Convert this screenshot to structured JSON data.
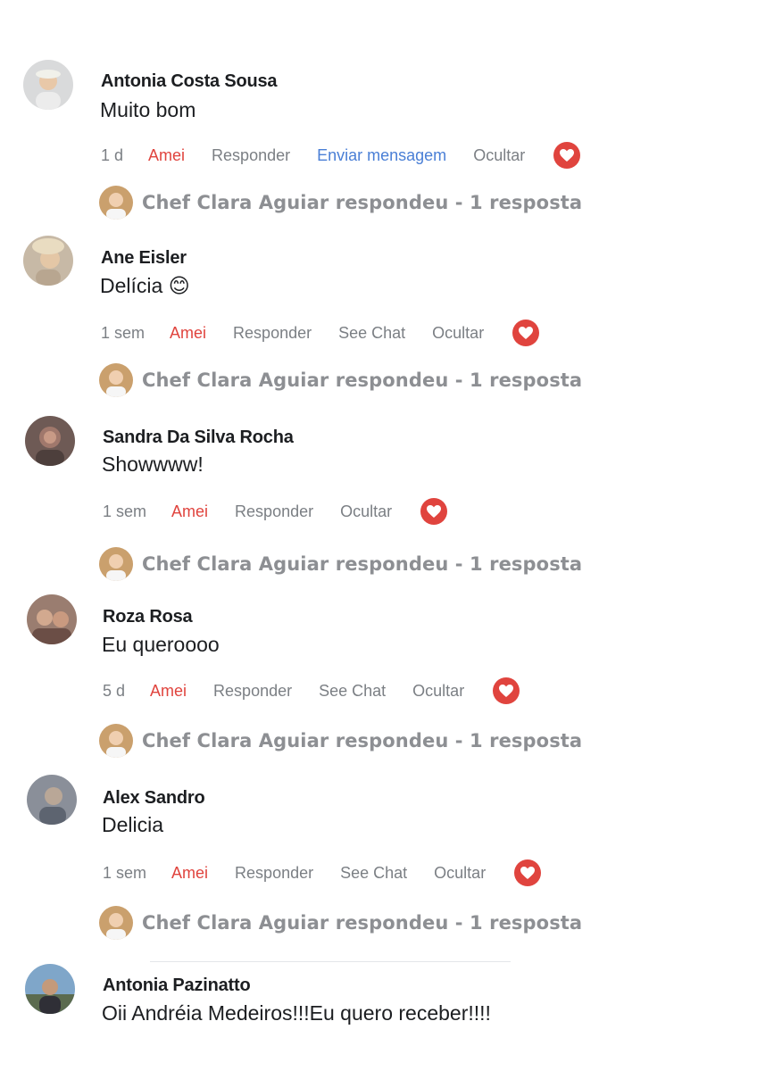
{
  "colors": {
    "reaction": "#e0443e",
    "link": "#4a7fd6",
    "muted": "#7b7f84",
    "reply_text": "#8d8f93"
  },
  "icons": {
    "reaction": "heart-icon"
  },
  "comments": [
    {
      "author": "Antonia Costa Sousa",
      "text": "Muito bom",
      "time": "1 d",
      "reaction_label": "Amei",
      "actions": [
        "Responder",
        "Enviar mensagem",
        "Ocultar"
      ],
      "reply_summary": "Chef Clara Aguiar respondeu - 1 resposta"
    },
    {
      "author": "Ane Eisler",
      "text": "Delícia 😊",
      "time": "1 sem",
      "reaction_label": "Amei",
      "actions": [
        "Responder",
        "See Chat",
        "Ocultar"
      ],
      "reply_summary": "Chef Clara Aguiar respondeu - 1 resposta"
    },
    {
      "author": "Sandra Da Silva Rocha",
      "text": "Showwww!",
      "time": "1 sem",
      "reaction_label": "Amei",
      "actions": [
        "Responder",
        "Ocultar"
      ],
      "reply_summary": "Chef Clara Aguiar respondeu - 1 resposta"
    },
    {
      "author": "Roza Rosa",
      "text": "Eu queroooo",
      "time": "5 d",
      "reaction_label": "Amei",
      "actions": [
        "Responder",
        "See Chat",
        "Ocultar"
      ],
      "reply_summary": "Chef Clara Aguiar respondeu - 1 resposta"
    },
    {
      "author": "Alex Sandro",
      "text": "Delicia",
      "time": "1 sem",
      "reaction_label": "Amei",
      "actions": [
        "Responder",
        "See Chat",
        "Ocultar"
      ],
      "reply_summary": "Chef Clara Aguiar respondeu - 1 resposta"
    },
    {
      "author": "Antonia Pazinatto",
      "text": "Oii Andréia Medeiros!!!Eu quero receber!!!!"
    }
  ]
}
